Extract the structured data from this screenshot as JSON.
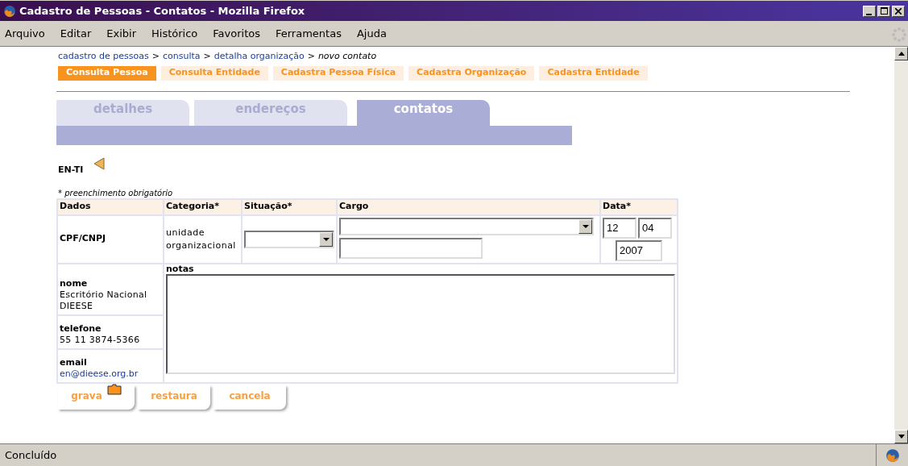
{
  "window": {
    "title": "Cadastro de Pessoas - Contatos - Mozilla Firefox"
  },
  "menu": [
    "Arquivo",
    "Editar",
    "Exibir",
    "Histórico",
    "Favoritos",
    "Ferramentas",
    "Ajuda"
  ],
  "breadcrumb": {
    "links": [
      "cadastro de pessoas",
      "consulta",
      "detalha organização"
    ],
    "separator": ">",
    "current": "novo contato"
  },
  "nav": [
    {
      "label": "Consulta Pessoa",
      "selected": true
    },
    {
      "label": "Consulta Entidade",
      "selected": false
    },
    {
      "label": "Cadastra Pessoa Física",
      "selected": false
    },
    {
      "label": "Cadastra Organização",
      "selected": false
    },
    {
      "label": "Cadastra Entidade",
      "selected": false
    }
  ],
  "tabs": [
    {
      "label": "detalhes",
      "selected": false
    },
    {
      "label": "endereços",
      "selected": false
    },
    {
      "label": "contatos",
      "selected": true
    }
  ],
  "entity": "EN-TI",
  "required_note": "* preenchimento obrigatório",
  "table": {
    "columns": [
      "Dados",
      "Categoria*",
      "Situação*",
      "Cargo",
      "Data*"
    ],
    "doc_label": "CPF/CNPJ",
    "categoria": "unidade organizacional",
    "date": {
      "day": "12",
      "month": "04",
      "year": "2007"
    },
    "notes_label": "notas",
    "details": [
      {
        "label": "nome",
        "value": "Escritório Nacional DIEESE",
        "kind": "text"
      },
      {
        "label": "telefone",
        "value": "55 11 3874-5366",
        "kind": "text"
      },
      {
        "label": "email",
        "value": "en@dieese.org.br",
        "kind": "link"
      }
    ]
  },
  "buttons": [
    "grava",
    "restaura",
    "cancela"
  ],
  "status_bar": "Concluído"
}
